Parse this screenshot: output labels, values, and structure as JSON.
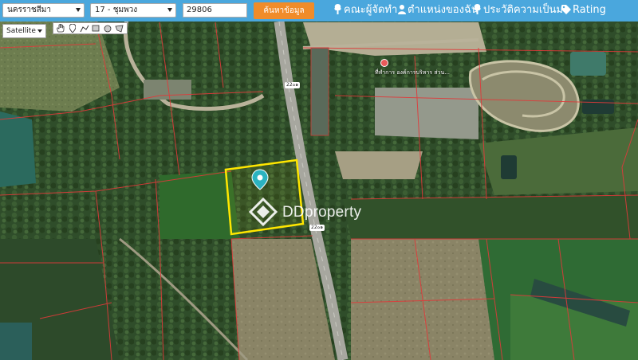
{
  "topbar": {
    "province": "นครราชสีมา",
    "district": "17 - ชุมพวง",
    "parcel_code": "29806",
    "search_button": "ค้นหาข้อมูล",
    "nav": {
      "committee": "คณะผู้จัดทำ",
      "my_position": "ตำแหน่งของฉัน",
      "history": "ประวัติความเป็นมา",
      "rating": "Rating"
    }
  },
  "map": {
    "map_type": "Satellite",
    "road_label_1": "22๐๑",
    "road_label_2": "22๐๑",
    "poi_label": "ที่ทำการ องค์การบริหาร ส่วน...",
    "watermark": "DDproperty",
    "colors": {
      "parcel_outline": "#ffe600",
      "boundary_lines": "#e03a3a",
      "header_bar": "#4aa7dd",
      "search_button": "#f08c2a",
      "marker": "#2bb3c0"
    }
  },
  "icons": {
    "committee": "tree-icon",
    "my_position": "person-icon",
    "history": "tree-icon",
    "rating": "tag-icon",
    "tools": [
      "hand-icon",
      "marker-icon",
      "polyline-icon",
      "rectangle-icon",
      "circle-icon",
      "polygon-icon"
    ]
  }
}
